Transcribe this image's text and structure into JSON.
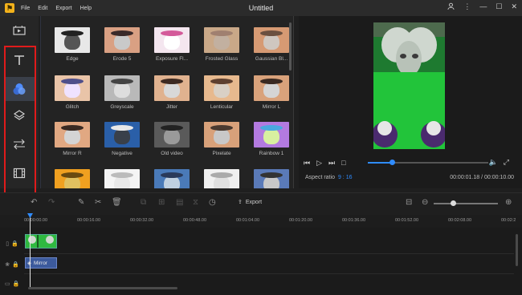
{
  "app": {
    "title": "Untitled",
    "logo_glyph": "⚑",
    "menu": [
      "File",
      "Edit",
      "Export",
      "Help"
    ]
  },
  "window_controls": [
    "user-icon",
    "more-icon",
    "minimize-icon",
    "maximize-icon",
    "close-icon"
  ],
  "left_panel": {
    "items": [
      "media-icon",
      "text-icon",
      "filters-icon",
      "overlays-icon",
      "transitions-icon",
      "elements-icon"
    ],
    "selected": "filters-icon",
    "highlight_color": "#e01b1b"
  },
  "effects": [
    {
      "label": "Edge",
      "bg": "#e8e8e8",
      "face": "#555555",
      "hat": "#222222"
    },
    {
      "label": "Erode 5",
      "bg": "#d9a083",
      "face": "#c9c9c9",
      "hat": "#3a2a2a"
    },
    {
      "label": "Exposure Fl...",
      "bg": "#f4e6ef",
      "face": "#ffffff",
      "hat": "#d45a9a"
    },
    {
      "label": "Frosted Glass",
      "bg": "#c9a888",
      "face": "#c2b0a0",
      "hat": "#a08070"
    },
    {
      "label": "Gaussian Bl...",
      "bg": "#d69a73",
      "face": "#cfc7c0",
      "hat": "#6b5040"
    },
    {
      "label": "Glitch",
      "bg": "#e9c4a8",
      "face": "#efe2ff",
      "hat": "#4f4f8a"
    },
    {
      "label": "Greyscale",
      "bg": "#b9b9b9",
      "face": "#dddddd",
      "hat": "#444444"
    },
    {
      "label": "Jitter",
      "bg": "#e0b28f",
      "face": "#d8d8d8",
      "hat": "#3d2a22"
    },
    {
      "label": "Lenticular",
      "bg": "#e7b98e",
      "face": "#d9d0c5",
      "hat": "#5e4030"
    },
    {
      "label": "Mirror L",
      "bg": "#d9a27b",
      "face": "#d5d5d5",
      "hat": "#3a2a22"
    },
    {
      "label": "Mirror R",
      "bg": "#e1a882",
      "face": "#d4d4d4",
      "hat": "#3a2a22"
    },
    {
      "label": "Negative",
      "bg": "#2a5fa8",
      "face": "#39404a",
      "hat": "#e8e8e8"
    },
    {
      "label": "Old video",
      "bg": "#5a5a5a",
      "face": "#9a9a9a",
      "hat": "#222222"
    },
    {
      "label": "Pixelate",
      "bg": "#d8a17a",
      "face": "#c8c8c8",
      "hat": "#4a3a30"
    },
    {
      "label": "Rainbow 1",
      "bg": "#b37ae0",
      "face": "#d8f0a0",
      "hat": "#4aa8e0"
    },
    {
      "label": "",
      "bg": "#f0a020",
      "face": "#e0c060",
      "hat": "#6a4a10"
    },
    {
      "label": "",
      "bg": "#f4f4f4",
      "face": "#e8e8e8",
      "hat": "#bbbbbb"
    },
    {
      "label": "",
      "bg": "#4a7ab8",
      "face": "#c0d0e0",
      "hat": "#2a3a5a"
    },
    {
      "label": "",
      "bg": "#f0f0f0",
      "face": "#e0e0e0",
      "hat": "#aaaaaa"
    },
    {
      "label": "",
      "bg": "#5a7ab8",
      "face": "#c8c8c8",
      "hat": "#333333"
    }
  ],
  "preview": {
    "aspect_label": "Aspect ratio",
    "aspect_value": "9 : 16",
    "time": "00:00:01.18 / 00:00:10.00",
    "progress": 0.2
  },
  "toolbar": {
    "export_label": "Export",
    "zoom_level": 0.3
  },
  "timeline": {
    "ticks": [
      "00:00:00.00",
      "00:00:16.00",
      "00:00:32.00",
      "00:00:48.00",
      "00:01:04.00",
      "00:01:20.00",
      "00:01:36.00",
      "00:01:52.00",
      "00:02:08.00",
      "00:02:2"
    ],
    "fx_clip_label": "Mirror"
  }
}
